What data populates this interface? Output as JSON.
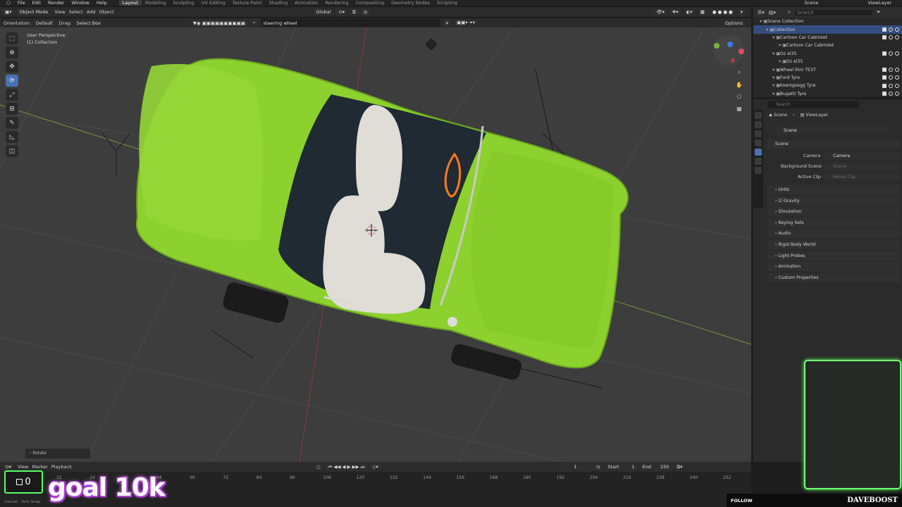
{
  "menu": [
    "File",
    "Edit",
    "Render",
    "Window",
    "Help"
  ],
  "workspaces": [
    "Layout",
    "Modeling",
    "Sculpting",
    "UV Editing",
    "Texture Paint",
    "Shading",
    "Animation",
    "Rendering",
    "Compositing",
    "Geometry Nodes",
    "Scripting"
  ],
  "active_workspace": "Layout",
  "scene_name": "Scene",
  "viewlayer_name": "ViewLayer",
  "header": {
    "mode": "Object Mode",
    "view": "View",
    "select": "Select",
    "add": "Add",
    "object": "Object",
    "transform": "Global"
  },
  "header2": {
    "orientation_label": "Orientation:",
    "orientation": "Default",
    "drag_label": "Drag:",
    "drag": "Select Box",
    "search_value": "steering wheel",
    "options": "Options"
  },
  "viewport_info": {
    "perspective": "User Perspective",
    "collection": "(1) Collection"
  },
  "last_op": "Rotate",
  "outliner": {
    "search_placeholder": "Search",
    "rows": [
      {
        "label": "Scene Collection",
        "indent": 1
      },
      {
        "label": "Collection",
        "indent": 2
      },
      {
        "label": "Cartoon Car Cabriolet",
        "indent": 3
      },
      {
        "label": "Cartoon Car Cabriolet",
        "indent": 4
      },
      {
        "label": "Oz el35",
        "indent": 3
      },
      {
        "label": "Oz el35",
        "indent": 4
      },
      {
        "label": "Wheel Rim TE37",
        "indent": 3
      },
      {
        "label": "Ford Tyre",
        "indent": 3
      },
      {
        "label": "Koenigsegg Tyre",
        "indent": 3
      },
      {
        "label": "Bugatti Tyre",
        "indent": 3
      }
    ]
  },
  "properties": {
    "search_placeholder": "Search",
    "breadcrumb_scene": "Scene",
    "breadcrumb_viewlayer": "ViewLayer",
    "scene_field": "Scene",
    "section_scene": "Scene",
    "camera_label": "Camera",
    "camera_value": "Camera",
    "bg_label": "Background Scene",
    "bg_value": "Scene",
    "clip_label": "Active Clip",
    "clip_value": "Movie Clip",
    "sections": [
      "Units",
      "Gravity",
      "Simulation",
      "Keying Sets",
      "Audio",
      "Rigid Body World",
      "Light Probes",
      "Animation",
      "Custom Properties"
    ]
  },
  "timeline": {
    "view": "View",
    "marker": "Marker",
    "playback": "Playback",
    "current_frame": "1",
    "start_label": "Start",
    "start": "1",
    "end_label": "End",
    "end": "250",
    "ticks": [
      "12",
      "24",
      "36",
      "48",
      "60",
      "72",
      "84",
      "96",
      "108",
      "120",
      "132",
      "144",
      "156",
      "168",
      "180",
      "192",
      "204",
      "216",
      "228",
      "240",
      "252"
    ]
  },
  "status": {
    "cancel": "Cancel",
    "axis": "Axis Snap"
  },
  "overlay": {
    "goal_count": "0",
    "goal_text": "goal 10k",
    "follow": "FOLLOW",
    "streamer": "DAVEBOOST"
  },
  "colors": {
    "car_body": "#8cd12e",
    "seat": "#e0dcd6",
    "accent_green": "#55ff66",
    "accent_purple": "#b040d8",
    "active_blue": "#4772b3"
  }
}
